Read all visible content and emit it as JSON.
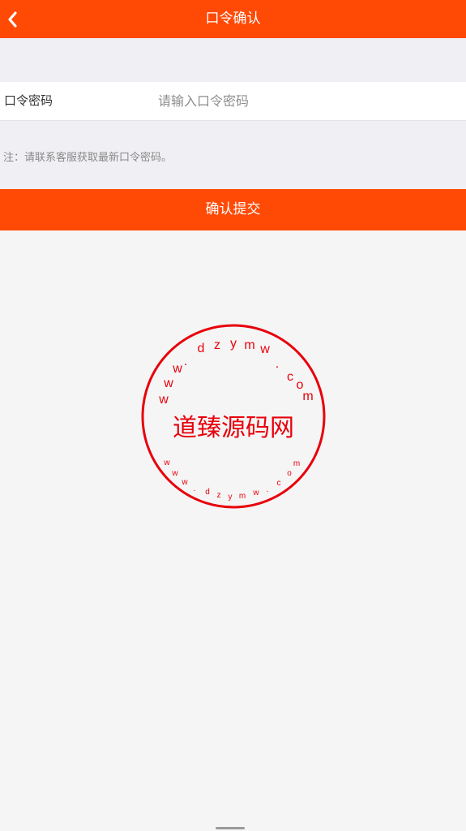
{
  "header": {
    "title": "口令确认",
    "back_icon": "chevron-left-icon"
  },
  "form": {
    "label": "口令密码",
    "placeholder": "请输入口令密码",
    "value": ""
  },
  "note": {
    "text": "注：请联系客服获取最新口令密码。"
  },
  "submit": {
    "label": "确认提交"
  },
  "watermark": {
    "center_text": "道臻源码网",
    "ring_text_top": "www.dzymw.com",
    "ring_text_bottom": "www.dzymw.com"
  },
  "colors": {
    "accent": "#ff4a06",
    "stamp": "#e8000b",
    "background": "#f5f5f5"
  }
}
